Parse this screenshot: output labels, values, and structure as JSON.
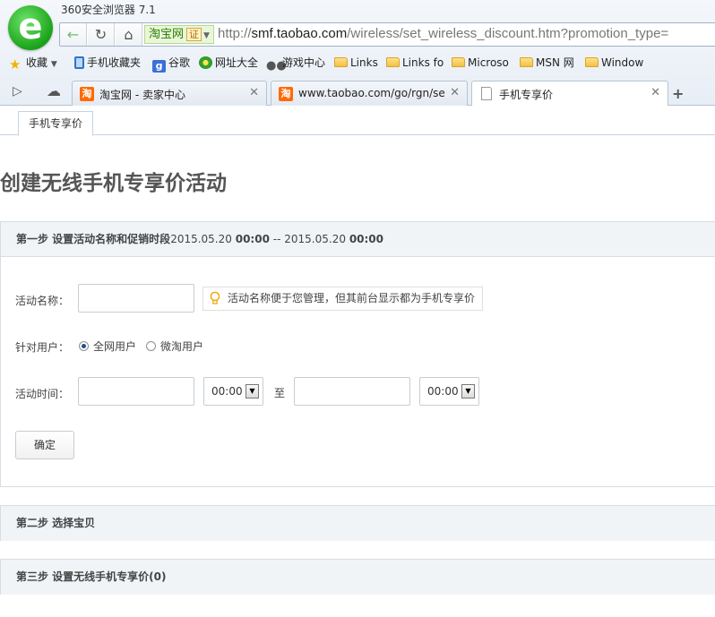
{
  "window": {
    "title": "360安全浏览器 7.1"
  },
  "addressbar": {
    "site_name": "淘宝网",
    "cert_label": "证",
    "url_scheme": "http://",
    "url_host": "smf.taobao.com",
    "url_path": "/wireless/set_wireless_discount.htm?promotion_type="
  },
  "bookmarks": [
    {
      "label": "收藏",
      "icon": "star-icon"
    },
    {
      "label": "手机收藏夹",
      "icon": "phone-icon"
    },
    {
      "label": "谷歌",
      "icon": "google-icon"
    },
    {
      "label": "网址大全",
      "icon": "globe-icon"
    },
    {
      "label": "游戏中心",
      "icon": "gamepad-icon"
    },
    {
      "label": "Links",
      "icon": "folder-icon"
    },
    {
      "label": "Links fo",
      "icon": "folder-icon"
    },
    {
      "label": "Microso",
      "icon": "folder-icon"
    },
    {
      "label": "MSN 网",
      "icon": "folder-icon"
    },
    {
      "label": "Window",
      "icon": "folder-icon"
    }
  ],
  "tabs": [
    {
      "label": "淘宝网 - 卖家中心",
      "favicon": "淘"
    },
    {
      "label": "www.taobao.com/go/rgn/se",
      "favicon": "淘"
    },
    {
      "label": "手机专享价",
      "favicon": ""
    }
  ],
  "page": {
    "subtab": "手机专享价",
    "title": "创建无线手机专享价活动",
    "step1": {
      "prefix": "第一步 设置活动名称和促销时段",
      "start_date": "2015.05.20",
      "start_time": "00:00",
      "separator": "--",
      "end_date": "2015.05.20",
      "end_time": "00:00"
    },
    "form": {
      "name_label": "活动名称：",
      "name_value": "",
      "name_tip": "活动名称便于您管理，但其前台显示都为手机专享价",
      "users_label": "针对用户：",
      "user_option_all": "全网用户",
      "user_option_weitao": "微淘用户",
      "time_label": "活动时间：",
      "start_time_select": "00:00",
      "to_label": "至",
      "end_time_select": "00:00",
      "confirm_button": "确定"
    },
    "step2": "第二步 选择宝贝",
    "step3": "第三步 设置无线手机专享价(0)"
  }
}
